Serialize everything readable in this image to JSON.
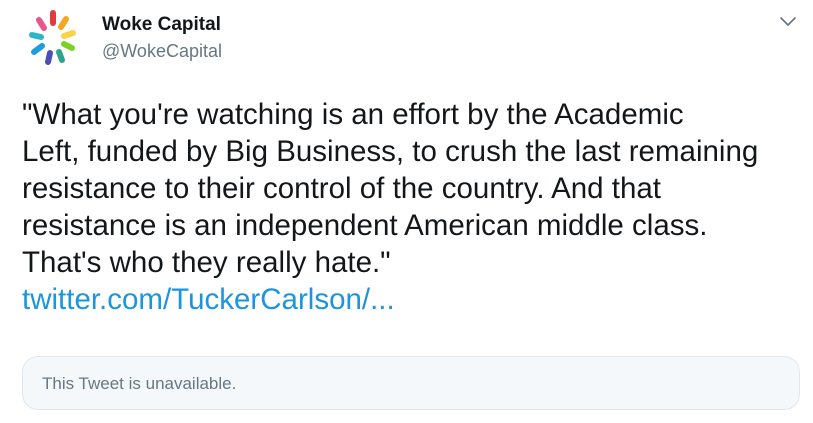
{
  "author": {
    "display_name": "Woke Capital",
    "handle": "@WokeCapital",
    "avatar_icon": "woke-capital-logo-icon"
  },
  "tweet": {
    "text": "\"What you're watching is an effort by the Academic\nLeft, funded by Big Business, to crush the last remaining\nresistance to their control of the country. And that\nresistance is an independent American middle class.\nThat's who they really hate.\"",
    "link_text": "twitter.com/TuckerCarlson/..."
  },
  "quoted_card": {
    "text": "This Tweet is unavailable."
  },
  "menu": {
    "caret_icon": "chevron-down-icon"
  },
  "colors": {
    "link": "#1b95e0",
    "secondary_text": "#657786",
    "card_background": "#f5f8fa",
    "card_border": "#e1e8ed"
  }
}
